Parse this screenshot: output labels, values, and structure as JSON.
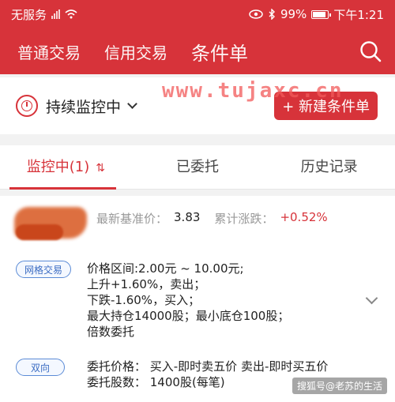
{
  "status_bar": {
    "carrier": "无服务",
    "battery": "99%",
    "time": "下午1:21",
    "icons": [
      "signal-icon",
      "wifi-icon",
      "eye-icon",
      "bluetooth-icon",
      "battery-icon"
    ]
  },
  "nav": {
    "tabs": [
      {
        "label": "普通交易"
      },
      {
        "label": "信用交易"
      },
      {
        "label": "条件单"
      }
    ],
    "search_icon": "search-icon"
  },
  "watermark": "www.tujaxc.cn",
  "monitor": {
    "title": "持续监控中",
    "new_button": "+ 新建条件单"
  },
  "tabs": [
    {
      "label": "监控中(1)"
    },
    {
      "label": "已委托"
    },
    {
      "label": "历史记录"
    }
  ],
  "order": {
    "latest_base_price_label": "最新基准价：",
    "latest_base_price": "3.83",
    "cum_change_label": "累计涨跌：",
    "cum_change": "+0.52%",
    "rule_badge": "网格交易",
    "rule_lines": [
      "价格区间:2.00元 ~ 10.00元;",
      "上升+1.60%，卖出；",
      "下跌-1.60%，买入；",
      "最大持仓14000股；最小底仓100股；",
      "倍数委托"
    ],
    "direction_badge": "双向",
    "entrust_price": "委托价格：  买入-即时卖五价  卖出-即时买五价",
    "entrust_qty": "委托股数：  1400股(每笔)"
  },
  "footer": {
    "source": "搜狐号@老苏的生活"
  },
  "colors": {
    "brand_red": "#d7333a",
    "badge_blue": "#3b6cc2"
  }
}
